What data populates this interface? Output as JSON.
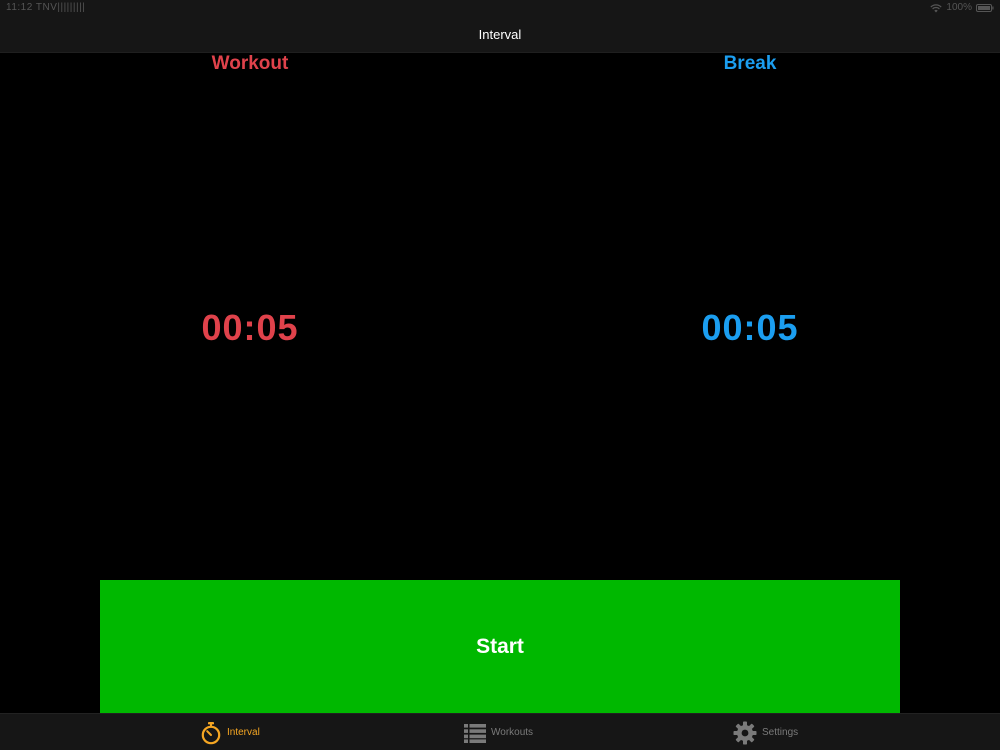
{
  "status_bar": {
    "time_text": "11:12 TNV|||||||||",
    "battery_text": "100%"
  },
  "nav": {
    "title": "Interval"
  },
  "workout": {
    "label": "Workout",
    "time": "00:05",
    "color": "#e0424b"
  },
  "break": {
    "label": "Break",
    "time": "00:05",
    "color": "#1b9ef0"
  },
  "start_button": {
    "label": "Start",
    "color": "#00b800"
  },
  "tab_bar": {
    "active_color": "#f5a623",
    "inactive_color": "#7a7a7a",
    "tabs": [
      {
        "label": "Interval",
        "icon": "stopwatch-icon",
        "active": true
      },
      {
        "label": "Workouts",
        "icon": "list-icon",
        "active": false
      },
      {
        "label": "Settings",
        "icon": "gear-icon",
        "active": false
      }
    ]
  }
}
